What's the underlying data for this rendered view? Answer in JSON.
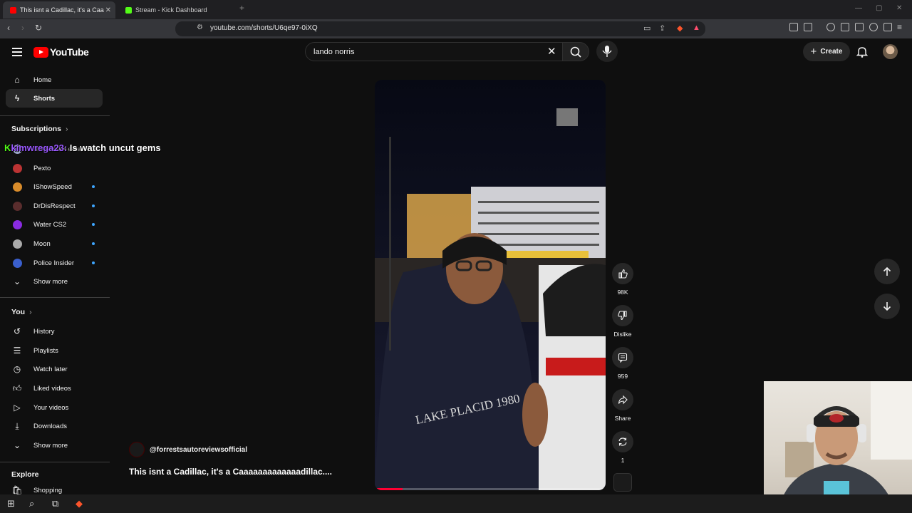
{
  "browser": {
    "tabs": [
      {
        "title": "This isnt a Cadillac, it's a Caa",
        "active": true,
        "favicon_color": "#ff0000"
      },
      {
        "title": "Stream - Kick Dashboard",
        "active": false,
        "favicon_color": "#53fc18"
      }
    ],
    "new_tab_icon": "plus-icon",
    "url": "youtube.com/shorts/U6qe97-0iXQ"
  },
  "header": {
    "logo_text": "YouTube",
    "search_value": "lando norris",
    "create_label": "Create"
  },
  "sidebar": {
    "main_items": [
      {
        "label": "Home",
        "icon": "home-icon"
      },
      {
        "label": "Shorts",
        "icon": "shorts-icon",
        "active": true
      }
    ],
    "subscriptions_heading": "Subscriptions",
    "subscriptions": [
      {
        "label": "HelloFassine extras",
        "color": "#9aa4c7",
        "dot": false
      },
      {
        "label": "Pexto",
        "color": "#b33",
        "dot": false
      },
      {
        "label": "IShowSpeed",
        "color": "#d98c2b",
        "dot": true
      },
      {
        "label": "DrDisRespect",
        "color": "#5a2d2d",
        "dot": true
      },
      {
        "label": "Water CS2",
        "color": "#8a2be2",
        "dot": true
      },
      {
        "label": "Moon",
        "color": "#aaa",
        "dot": true
      },
      {
        "label": "Police Insider",
        "color": "#3a5fcd",
        "dot": true
      }
    ],
    "show_more_1": "Show more",
    "you_heading": "You",
    "you_items": [
      {
        "label": "History",
        "icon": "history-icon"
      },
      {
        "label": "Playlists",
        "icon": "playlists-icon"
      },
      {
        "label": "Watch later",
        "icon": "clock-icon"
      },
      {
        "label": "Liked videos",
        "icon": "thumbs-up-icon"
      },
      {
        "label": "Your videos",
        "icon": "video-icon"
      },
      {
        "label": "Downloads",
        "icon": "download-icon"
      }
    ],
    "show_more_2": "Show more",
    "explore_heading": "Explore",
    "explore_items": [
      {
        "label": "Shopping",
        "icon": "shopping-icon"
      }
    ]
  },
  "chat_overlay": {
    "user": "kimwrega23:",
    "message": "Is watch uncut gems"
  },
  "short": {
    "channel": "@forrestsautoreviewsofficial",
    "title": "This isnt a Cadillac, it's a Caaaaaaaaaaaaadillac....",
    "progress_percent": 12,
    "actions": {
      "like_count": "98K",
      "dislike_label": "Dislike",
      "comment_count": "959",
      "share_label": "Share",
      "remix_count": "1"
    }
  }
}
